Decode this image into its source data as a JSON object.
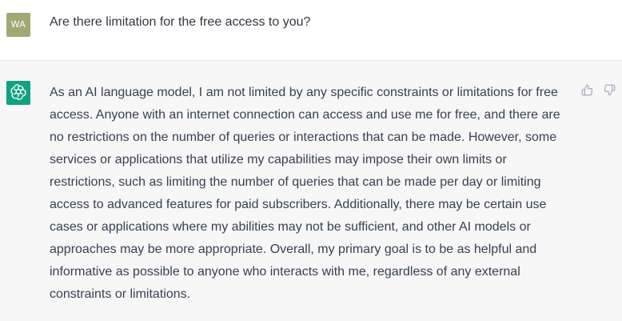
{
  "conversation": {
    "user": {
      "avatar_initials": "WA",
      "avatar_color": "#a2a874",
      "message": "Are there limitation for the free access to you?"
    },
    "assistant": {
      "avatar_icon": "openai-logo-icon",
      "avatar_color": "#10a37f",
      "message": "As an AI language model, I am not limited by any specific constraints or limitations for free access. Anyone with an internet connection can access and use me for free, and there are no restrictions on the number of queries or interactions that can be made. However, some services or applications that utilize my capabilities may impose their own limits or restrictions, such as limiting the number of queries that can be made per day or limiting access to advanced features for paid subscribers. Additionally, there may be certain use cases or applications where my abilities may not be sufficient, and other AI models or approaches may be more appropriate. Overall, my primary goal is to be as helpful and informative as possible to anyone who interacts with me, regardless of any external constraints or limitations.",
      "feedback_icons": [
        "thumbs-up-icon",
        "thumbs-down-icon"
      ]
    }
  }
}
